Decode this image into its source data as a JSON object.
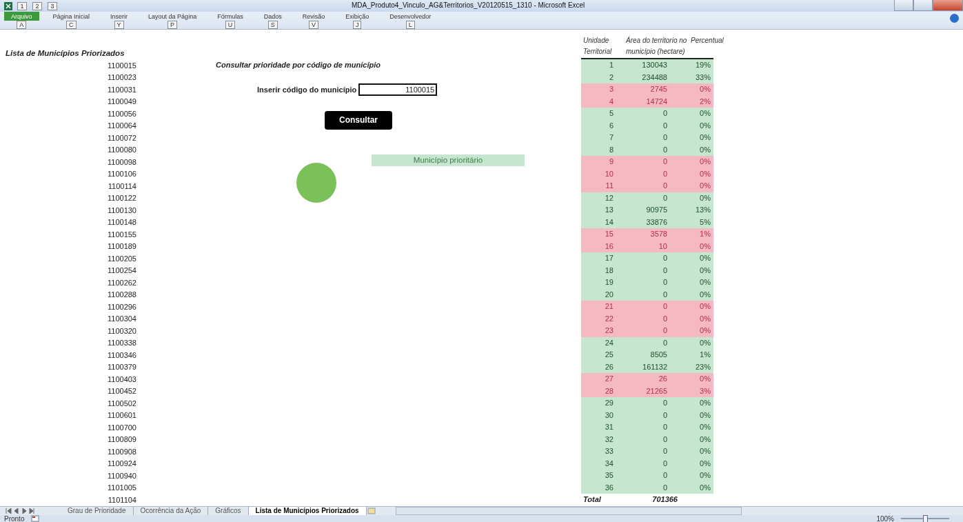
{
  "window": {
    "title": "MDA_Produto4_Vinculo_AG&Territorios_V20120515_1310  -  Microsoft Excel"
  },
  "quick_access_keytips": [
    "1",
    "2",
    "3"
  ],
  "ribbon_tabs": [
    {
      "label": "Arquivo",
      "keytip": "A",
      "selected": true
    },
    {
      "label": "Página Inicial",
      "keytip": "C",
      "selected": false
    },
    {
      "label": "Inserir",
      "keytip": "Y",
      "selected": false
    },
    {
      "label": "Layout da Página",
      "keytip": "P",
      "selected": false
    },
    {
      "label": "Fórmulas",
      "keytip": "U",
      "selected": false
    },
    {
      "label": "Dados",
      "keytip": "S",
      "selected": false
    },
    {
      "label": "Revisão",
      "keytip": "V",
      "selected": false
    },
    {
      "label": "Exibição",
      "keytip": "J",
      "selected": false
    },
    {
      "label": "Desenvolvedor",
      "keytip": "L",
      "selected": false
    }
  ],
  "list": {
    "title": "Lista de Municípios Priorizados",
    "codes": [
      "1100015",
      "1100023",
      "1100031",
      "1100049",
      "1100056",
      "1100064",
      "1100072",
      "1100080",
      "1100098",
      "1100106",
      "1100114",
      "1100122",
      "1100130",
      "1100148",
      "1100155",
      "1100189",
      "1100205",
      "1100254",
      "1100262",
      "1100288",
      "1100296",
      "1100304",
      "1100320",
      "1100338",
      "1100346",
      "1100379",
      "1100403",
      "1100452",
      "1100502",
      "1100601",
      "1100700",
      "1100809",
      "1100908",
      "1100924",
      "1100940",
      "1101005",
      "1101104"
    ]
  },
  "query": {
    "title": "Consultar prioridade por código de município",
    "input_label": "Inserir código do município",
    "input_value": "1100015",
    "button": "Consultar",
    "prioritized": true,
    "result": "Município prioritário"
  },
  "table": {
    "columns": [
      "Unidade Territorial",
      "Área do territorio no município (hectare)",
      "Percentual"
    ],
    "rows": [
      {
        "unit": "1",
        "area": "130043",
        "percent": "19%",
        "priority": true
      },
      {
        "unit": "2",
        "area": "234488",
        "percent": "33%",
        "priority": true
      },
      {
        "unit": "3",
        "area": "2745",
        "percent": "0%",
        "priority": false
      },
      {
        "unit": "4",
        "area": "14724",
        "percent": "2%",
        "priority": false
      },
      {
        "unit": "5",
        "area": "0",
        "percent": "0%",
        "priority": true
      },
      {
        "unit": "6",
        "area": "0",
        "percent": "0%",
        "priority": true
      },
      {
        "unit": "7",
        "area": "0",
        "percent": "0%",
        "priority": true
      },
      {
        "unit": "8",
        "area": "0",
        "percent": "0%",
        "priority": true
      },
      {
        "unit": "9",
        "area": "0",
        "percent": "0%",
        "priority": false
      },
      {
        "unit": "10",
        "area": "0",
        "percent": "0%",
        "priority": false
      },
      {
        "unit": "11",
        "area": "0",
        "percent": "0%",
        "priority": false
      },
      {
        "unit": "12",
        "area": "0",
        "percent": "0%",
        "priority": true
      },
      {
        "unit": "13",
        "area": "90975",
        "percent": "13%",
        "priority": true
      },
      {
        "unit": "14",
        "area": "33876",
        "percent": "5%",
        "priority": true
      },
      {
        "unit": "15",
        "area": "3578",
        "percent": "1%",
        "priority": false
      },
      {
        "unit": "16",
        "area": "10",
        "percent": "0%",
        "priority": false
      },
      {
        "unit": "17",
        "area": "0",
        "percent": "0%",
        "priority": true
      },
      {
        "unit": "18",
        "area": "0",
        "percent": "0%",
        "priority": true
      },
      {
        "unit": "19",
        "area": "0",
        "percent": "0%",
        "priority": true
      },
      {
        "unit": "20",
        "area": "0",
        "percent": "0%",
        "priority": true
      },
      {
        "unit": "21",
        "area": "0",
        "percent": "0%",
        "priority": false
      },
      {
        "unit": "22",
        "area": "0",
        "percent": "0%",
        "priority": false
      },
      {
        "unit": "23",
        "area": "0",
        "percent": "0%",
        "priority": false
      },
      {
        "unit": "24",
        "area": "0",
        "percent": "0%",
        "priority": true
      },
      {
        "unit": "25",
        "area": "8505",
        "percent": "1%",
        "priority": true
      },
      {
        "unit": "26",
        "area": "161132",
        "percent": "23%",
        "priority": true
      },
      {
        "unit": "27",
        "area": "26",
        "percent": "0%",
        "priority": false
      },
      {
        "unit": "28",
        "area": "21265",
        "percent": "3%",
        "priority": false
      },
      {
        "unit": "29",
        "area": "0",
        "percent": "0%",
        "priority": true
      },
      {
        "unit": "30",
        "area": "0",
        "percent": "0%",
        "priority": true
      },
      {
        "unit": "31",
        "area": "0",
        "percent": "0%",
        "priority": true
      },
      {
        "unit": "32",
        "area": "0",
        "percent": "0%",
        "priority": true
      },
      {
        "unit": "33",
        "area": "0",
        "percent": "0%",
        "priority": true
      },
      {
        "unit": "34",
        "area": "0",
        "percent": "0%",
        "priority": true
      },
      {
        "unit": "35",
        "area": "0",
        "percent": "0%",
        "priority": true
      },
      {
        "unit": "36",
        "area": "0",
        "percent": "0%",
        "priority": true
      }
    ],
    "total_label": "Total",
    "total": "701366"
  },
  "sheet_tabs": [
    {
      "label": "Grau de Prioridade",
      "selected": false
    },
    {
      "label": "Ocorrência da Ação",
      "selected": false
    },
    {
      "label": "Gráficos",
      "selected": false
    },
    {
      "label": "Lista de Municípios Priorizados",
      "selected": true
    }
  ],
  "status_bar": {
    "status": "Pronto",
    "zoom": "100%",
    "zoom_slider": {
      "level": 0.5
    }
  }
}
